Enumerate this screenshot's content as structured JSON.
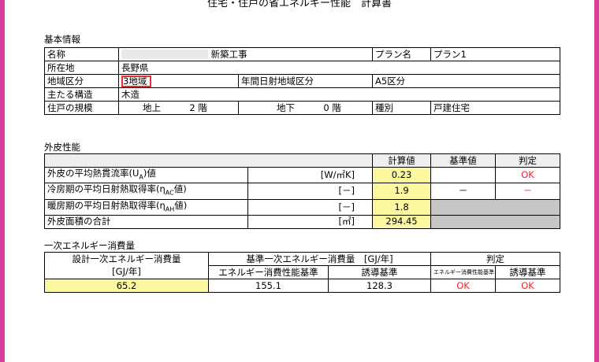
{
  "title": "住宅・住戸の省エネルギー性能　計算書",
  "basic": {
    "heading": "基本情報",
    "name_label": "名称",
    "name_value": "新築工事",
    "plan_label": "プラン名",
    "plan_value": "プラン1",
    "location_label": "所在地",
    "location_value": "長野県",
    "region_label": "地域区分",
    "region_value": "3地域",
    "solar_label": "年間日射地域区分",
    "solar_value": "A5区分",
    "structure_label": "主たる構造",
    "structure_value": "木造",
    "scale_label": "住戸の規模",
    "above_label": "地上",
    "above_value": "2",
    "floor_unit": "階",
    "below_label": "地下",
    "below_value": "0",
    "type_label": "種別",
    "type_value": "戸建住宅"
  },
  "envelope": {
    "heading": "外皮性能",
    "col_calc": "計算値",
    "col_std": "基準値",
    "col_judge": "判定",
    "rows": [
      {
        "label": "外皮の平均熱貫流率(U",
        "sub": "A",
        "label_tail": ")値",
        "unit": "[W/㎡K]",
        "calc": "0.23",
        "std": "",
        "judge": "OK"
      },
      {
        "label": "冷房期の平均日射熱取得率(η",
        "sub": "AC",
        "label_tail": "値)",
        "unit": "[－]",
        "calc": "1.9",
        "std": "－",
        "judge": "－"
      },
      {
        "label": "暖房期の平均日射熱取得率(η",
        "sub": "AH",
        "label_tail": "値)",
        "unit": "[－]",
        "calc": "1.8",
        "std": "",
        "judge": ""
      },
      {
        "label": "外皮面積の合計",
        "sub": "",
        "label_tail": "",
        "unit": "[㎡]",
        "calc": "294.45",
        "std": "",
        "judge": ""
      }
    ]
  },
  "energy": {
    "heading": "一次エネルギー消費量",
    "design_label": "設計一次エネルギー消費量",
    "design_unit": "[GJ/年]",
    "base_label": "基準一次エネルギー消費量　[GJ/年]",
    "judge_label": "判定",
    "perf_std_label": "エネルギー消費性能基準",
    "guide_std_label": "誘導基準",
    "judge_perf_label": "エネルギー消費性能基準",
    "judge_guide_label": "誘導基準",
    "design_value": "65.2",
    "perf_std_value": "155.1",
    "guide_std_value": "128.3",
    "judge_perf_value": "OK",
    "judge_guide_value": "OK"
  },
  "colors": {
    "frame": "#d63f9a",
    "highlight": "#e0303a",
    "ok": "#f0222a",
    "yellow": "#fbf8a0",
    "gray": "#c6c6c6"
  }
}
